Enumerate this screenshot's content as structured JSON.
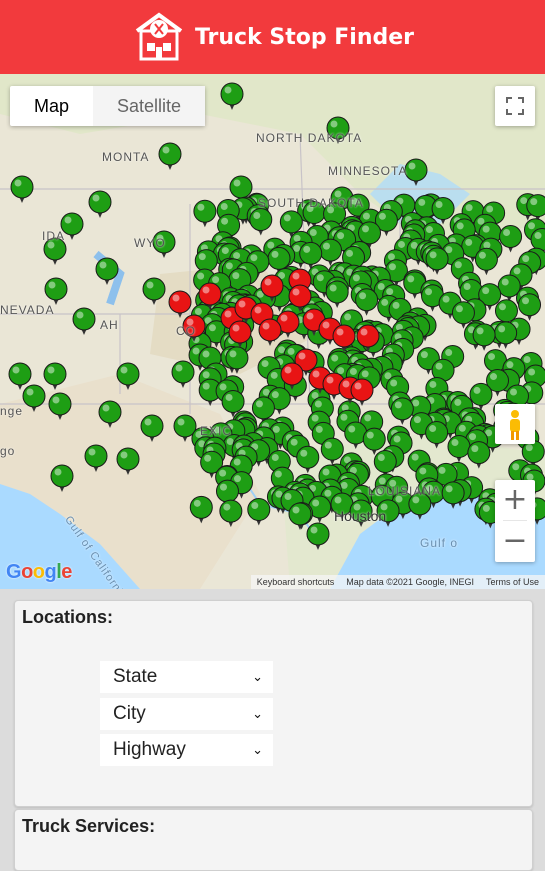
{
  "app": {
    "title": "Truck Stop Finder"
  },
  "map": {
    "type_controls": {
      "map_label": "Map",
      "satellite_label": "Satellite"
    },
    "labels": {
      "north_dakota": "NORTH DAKOTA",
      "south_dakota": "SOUTH DAKOTA",
      "montana": "MONTA",
      "minnesota": "MINNESOTA",
      "idaho": "IDA",
      "wyoming": "WYO",
      "nevada": "NEVADA",
      "utah": "AH",
      "colorado": "CO",
      "mexico": "EXIC",
      "arizona": "nge",
      "diego": "go",
      "houston": "Houston",
      "louisiana": "LOUISIANA",
      "gulf_of_california": "Gulf of California",
      "gulf": "Gulf o"
    },
    "zoom": {
      "in": "+",
      "out": "−"
    },
    "google_logo": "Google",
    "attribution": {
      "shortcuts": "Keyboard shortcuts",
      "data": "Map data ©2021 Google, INEGI",
      "terms": "Terms of Use"
    },
    "marker_colors": {
      "default": "#1e9e14",
      "highlight": "#e81414"
    }
  },
  "locations": {
    "title": "Locations:",
    "state": "State",
    "city": "City",
    "highway": "Highway"
  },
  "services": {
    "title": "Truck Services:"
  }
}
